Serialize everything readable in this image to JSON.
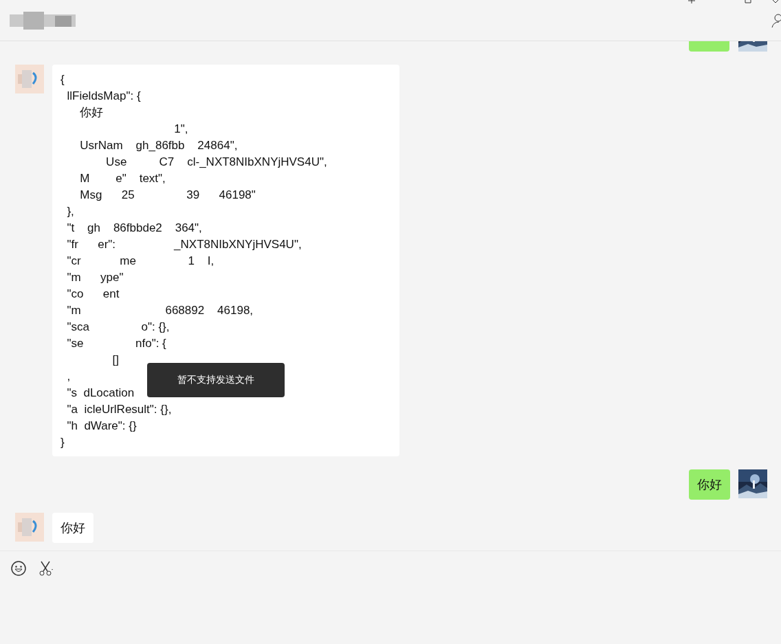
{
  "messages": [
    {
      "kind": "partial",
      "outgoing": true
    },
    {
      "kind": "code",
      "outgoing": false,
      "lines": [
        "{",
        "  llFieldsMap\": {",
        "      你好",
        "                                   1\",",
        "      UsrNam    gh_86fbb    24864\",",
        "              Use          C7    cl-_NXT8NIbXNYjHVS4U\",",
        "      M        e\"    text\",",
        "      Msg      25                39      46198\"",
        "  },",
        "  \"t    gh    86fbbde2    364\",",
        "  \"fr      er\":                  _NXT8NIbXNYjHVS4U\",",
        "  \"cr            me                1    I,",
        "  \"m      ype\"",
        "  \"co      ent",
        "  \"m                          668892    46198,",
        "  \"sca                o\": {},",
        "  \"se                nfo\": {",
        "                []",
        "  ,",
        "  \"s  dLocation",
        "  \"a  icleUrlResult\": {},",
        "  \"h  dWare\": {}",
        "}"
      ]
    },
    {
      "kind": "text",
      "outgoing": true,
      "text": "你好"
    },
    {
      "kind": "text",
      "outgoing": false,
      "text": "你好"
    }
  ],
  "toast": {
    "text": "暂不支持发送文件"
  }
}
